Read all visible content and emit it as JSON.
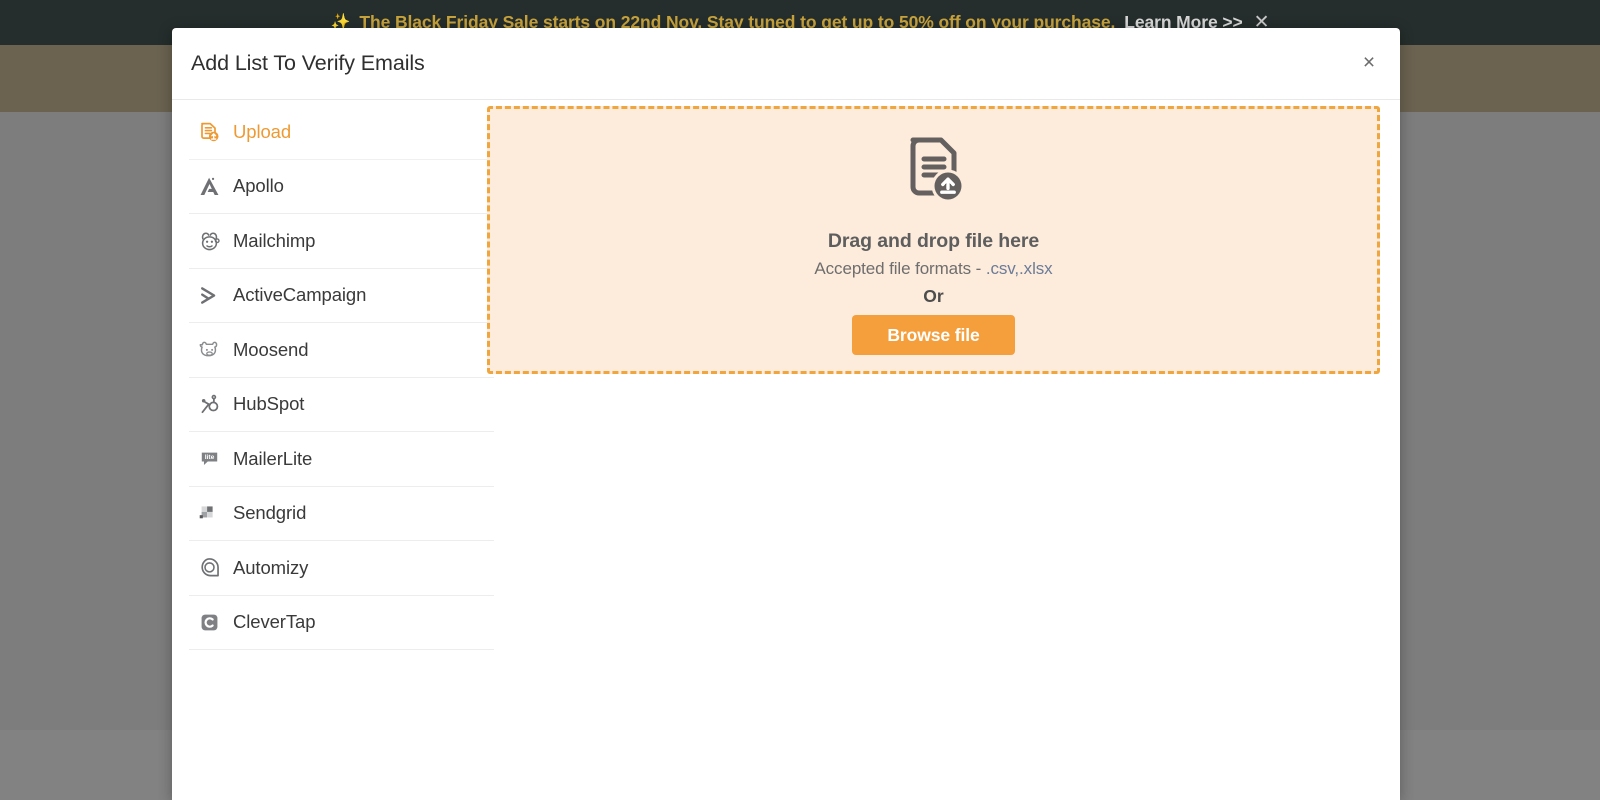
{
  "promo_banner": {
    "sparkle_icon": "✨",
    "text": "The Black Friday Sale starts on 22nd Nov. Stay tuned to get up to 50% off on your purchase.",
    "link_label": "Learn More >>",
    "close_label": "✕"
  },
  "modal": {
    "title": "Add List To Verify Emails",
    "close_label": "×"
  },
  "providers": [
    {
      "label": "Upload",
      "icon": "upload-document-icon",
      "active": true
    },
    {
      "label": "Apollo",
      "icon": "apollo-icon",
      "active": false
    },
    {
      "label": "Mailchimp",
      "icon": "mailchimp-icon",
      "active": false
    },
    {
      "label": "ActiveCampaign",
      "icon": "activecampaign-icon",
      "active": false
    },
    {
      "label": "Moosend",
      "icon": "moosend-icon",
      "active": false
    },
    {
      "label": "HubSpot",
      "icon": "hubspot-icon",
      "active": false
    },
    {
      "label": "MailerLite",
      "icon": "mailerlite-icon",
      "active": false
    },
    {
      "label": "Sendgrid",
      "icon": "sendgrid-icon",
      "active": false
    },
    {
      "label": "Automizy",
      "icon": "automizy-icon",
      "active": false
    },
    {
      "label": "CleverTap",
      "icon": "clevertap-icon",
      "active": false
    }
  ],
  "dropzone": {
    "icon": "file-upload-icon",
    "title": "Drag and drop file here",
    "formats_label": "Accepted file formats -",
    "formats_value": ".csv,.xlsx",
    "or_label": "Or",
    "browse_label": "Browse file"
  },
  "colors": {
    "accent": "#F59E3C",
    "accent_border": "#EFA63F",
    "dropzone_bg": "#FDEBDC",
    "banner_bg": "#252E2C",
    "banner_text": "#C8A33C",
    "navbar_bg": "#6B6250",
    "overlay": "#7D7D7D",
    "format_link": "#6B7C99"
  }
}
